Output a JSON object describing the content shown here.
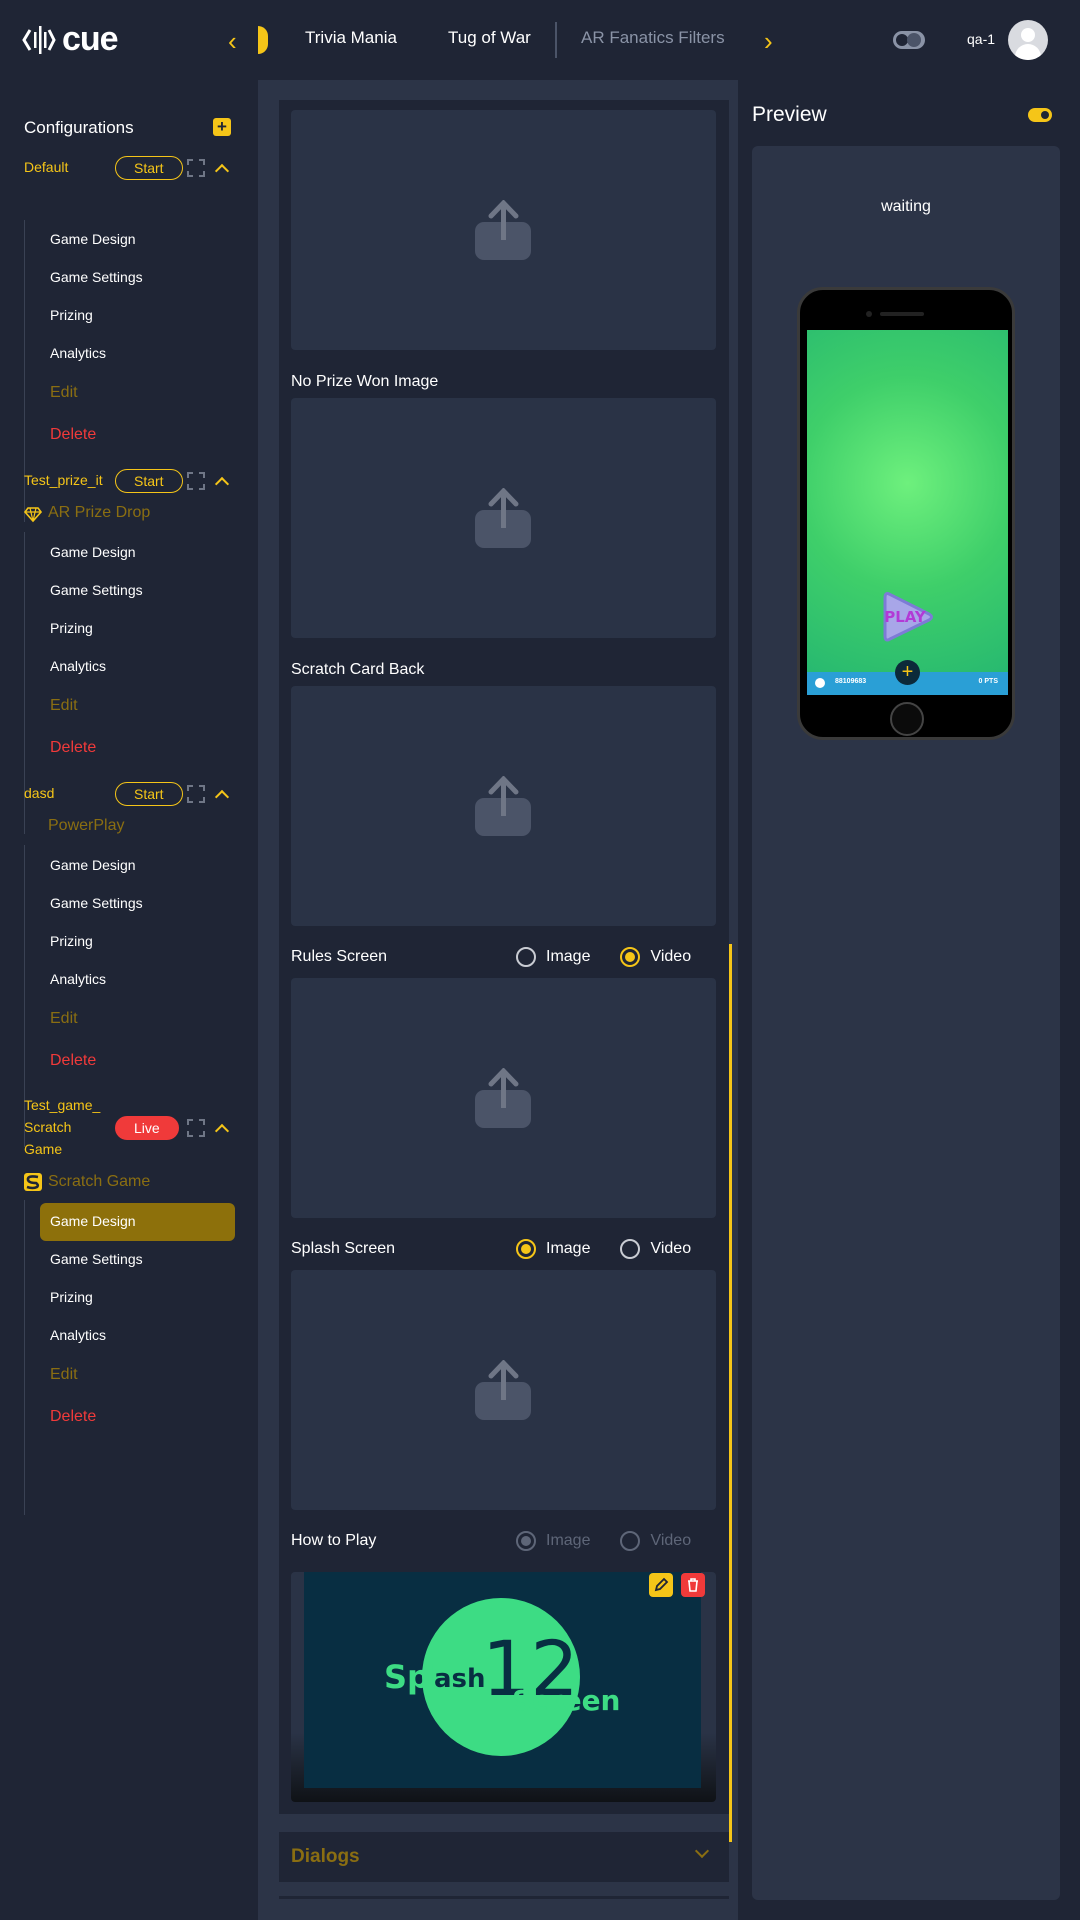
{
  "app": {
    "logo_text": "cue",
    "user": "qa-1"
  },
  "tabs": [
    {
      "label": "Trivia Mania"
    },
    {
      "label": "Tug of War"
    },
    {
      "label": "AR Fanatics Filters"
    }
  ],
  "sidebar": {
    "title": "Configurations",
    "configs": [
      {
        "name": "Default",
        "status": "Start",
        "game": "",
        "items": [
          "Game Design",
          "Game Settings",
          "Prizing",
          "Analytics"
        ],
        "edit": "Edit",
        "delete": "Delete"
      },
      {
        "name": "Test_prize_it",
        "status": "Start",
        "game": "AR Prize Drop",
        "items": [
          "Game Design",
          "Game Settings",
          "Prizing",
          "Analytics"
        ],
        "edit": "Edit",
        "delete": "Delete"
      },
      {
        "name": "dasd",
        "status": "Start",
        "game": "PowerPlay",
        "items": [
          "Game Design",
          "Game Settings",
          "Prizing",
          "Analytics"
        ],
        "edit": "Edit",
        "delete": "Delete"
      },
      {
        "name_lines": [
          "Test_game_",
          "Scratch",
          "Game"
        ],
        "status": "Live",
        "game": "Scratch Game",
        "items": [
          "Game Design",
          "Game Settings",
          "Prizing",
          "Analytics"
        ],
        "edit": "Edit",
        "delete": "Delete",
        "active_item": "Game Design"
      }
    ]
  },
  "main": {
    "sections": [
      {
        "label": "No Prize Won Image"
      },
      {
        "label": "Scratch Card Back"
      },
      {
        "label": "Rules Screen",
        "options": [
          "Image",
          "Video"
        ],
        "selected": "Video"
      },
      {
        "label": "Splash Screen",
        "options": [
          "Image",
          "Video"
        ],
        "selected": "Image"
      },
      {
        "label": "How to Play",
        "options": [
          "Image",
          "Video"
        ],
        "selected": "Image",
        "disabled": true
      }
    ],
    "media_text": {
      "left": "Spl",
      "mid": "ash",
      "number": "12",
      "right": "Screen"
    },
    "dialogs": "Dialogs"
  },
  "preview": {
    "title": "Preview",
    "status": "waiting",
    "play": "PLAY",
    "bar_code": "88109683",
    "bar_points": "0 PTS"
  },
  "colors": {
    "accent": "#f5c518",
    "danger": "#f03a3a",
    "bg": "#1f2535",
    "panel": "#2c3447"
  }
}
